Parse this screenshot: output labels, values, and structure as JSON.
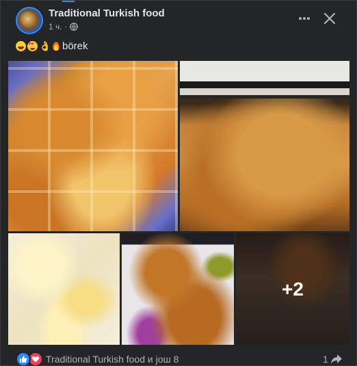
{
  "post": {
    "page_name": "Traditional Turkish food",
    "time": "1 ч.",
    "separator": "·",
    "caption_text": "börek",
    "caption_emojis": [
      "grinning-face",
      "heart-eyes-face",
      "ok-hand",
      "fire"
    ],
    "more_count_overlay": "+2"
  },
  "footer": {
    "reactions_text": "Traditional Turkish food и још 8",
    "share_count": "1"
  },
  "colors": {
    "background": "#242526",
    "like": "#2d88ff",
    "love": "#f33e58",
    "primary_text": "#e4e6eb",
    "secondary_text": "#b0b3b8"
  }
}
